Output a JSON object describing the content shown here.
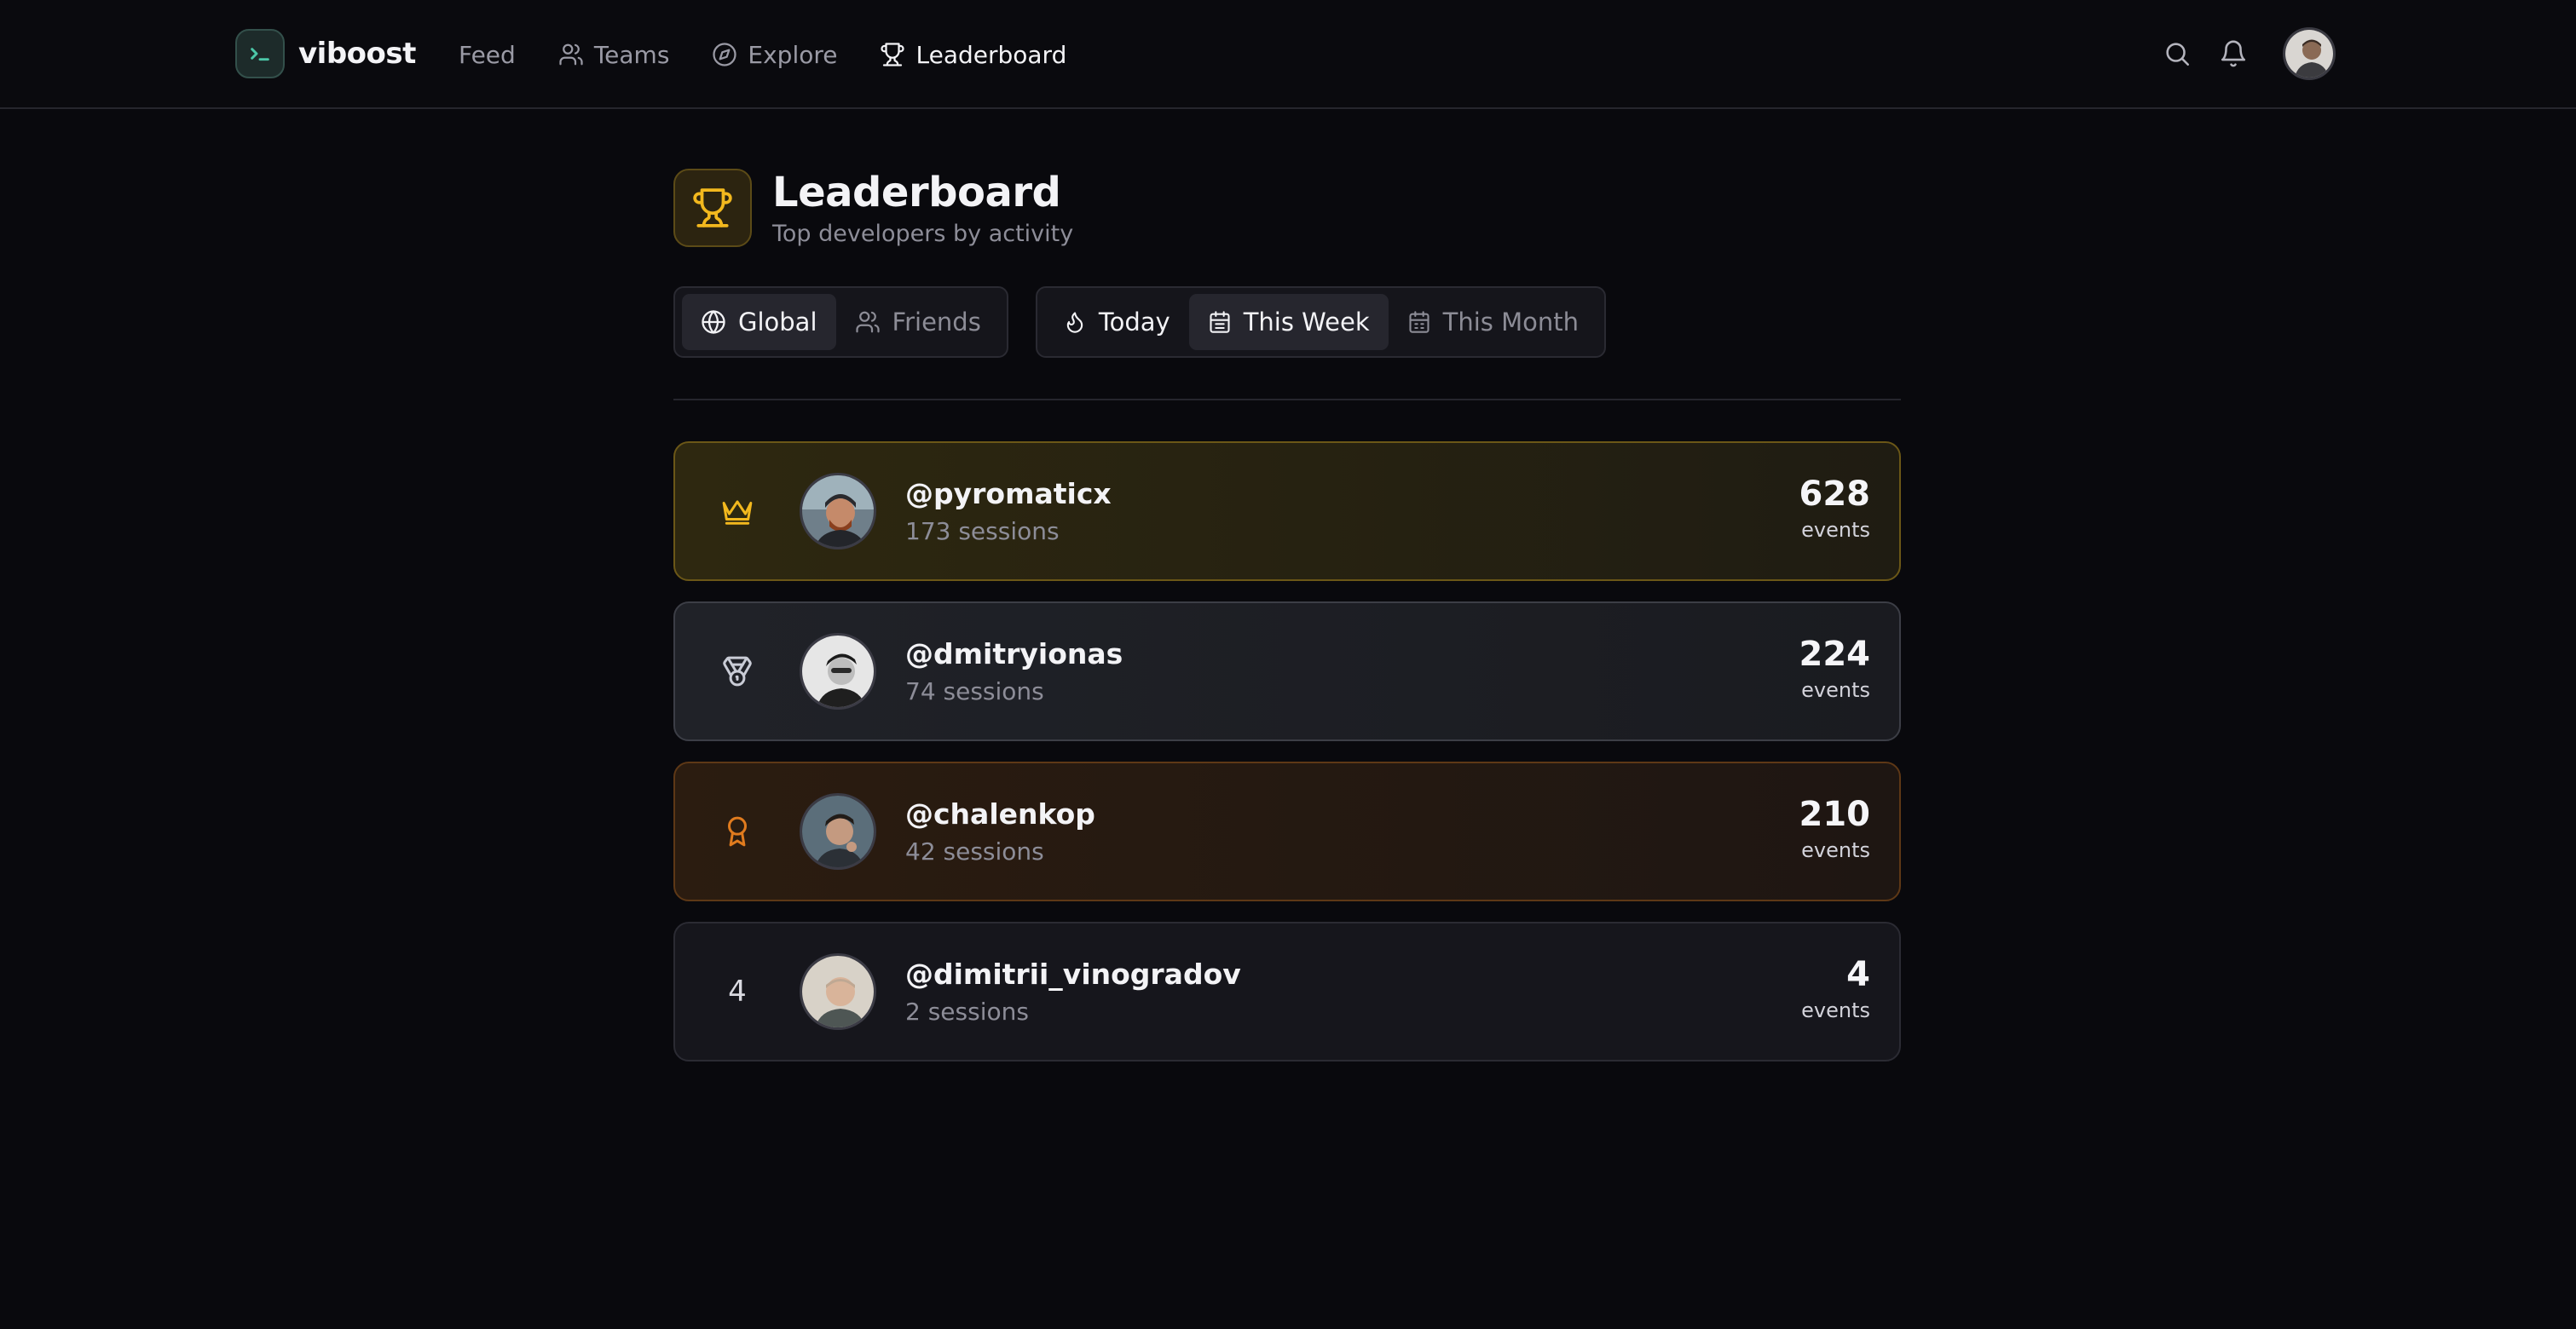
{
  "app": {
    "name": "viboost",
    "logo_icon": "terminal-icon",
    "accent": "#4cc7a8"
  },
  "nav": {
    "items": [
      {
        "label": "Feed",
        "icon": null
      },
      {
        "label": "Teams",
        "icon": "users-icon"
      },
      {
        "label": "Explore",
        "icon": "compass-icon"
      },
      {
        "label": "Leaderboard",
        "icon": "trophy-icon",
        "active": true
      }
    ]
  },
  "topbar": {
    "actions": [
      "search-icon",
      "bell-icon"
    ],
    "avatar": "user-avatar"
  },
  "page": {
    "title": "Leaderboard",
    "subtitle": "Top developers by activity",
    "icon": "trophy-icon",
    "icon_color": "#f2b81e"
  },
  "filters": {
    "scope": {
      "options": [
        "Global",
        "Friends"
      ],
      "selected": "Global"
    },
    "period": {
      "options": [
        "Today",
        "This Week",
        "This Month"
      ],
      "selected": "This Week"
    }
  },
  "leaderboard": [
    {
      "rank": 1,
      "rank_icon": "crown-icon",
      "handle": "@pyromaticx",
      "sessions": "173 sessions",
      "events": "628",
      "unit": "events",
      "tier_color": "#f2b81e"
    },
    {
      "rank": 2,
      "rank_icon": "medal-icon",
      "handle": "@dmitryionas",
      "sessions": "74 sessions",
      "events": "224",
      "unit": "events",
      "tier_color": "#c9ccd6"
    },
    {
      "rank": 3,
      "rank_icon": "award-icon",
      "handle": "@chalenkop",
      "sessions": "42 sessions",
      "events": "210",
      "unit": "events",
      "tier_color": "#e07b1e"
    },
    {
      "rank": 4,
      "rank_label": "4",
      "handle": "@dimitrii_vinogradov",
      "sessions": "2 sessions",
      "events": "4",
      "unit": "events"
    }
  ]
}
